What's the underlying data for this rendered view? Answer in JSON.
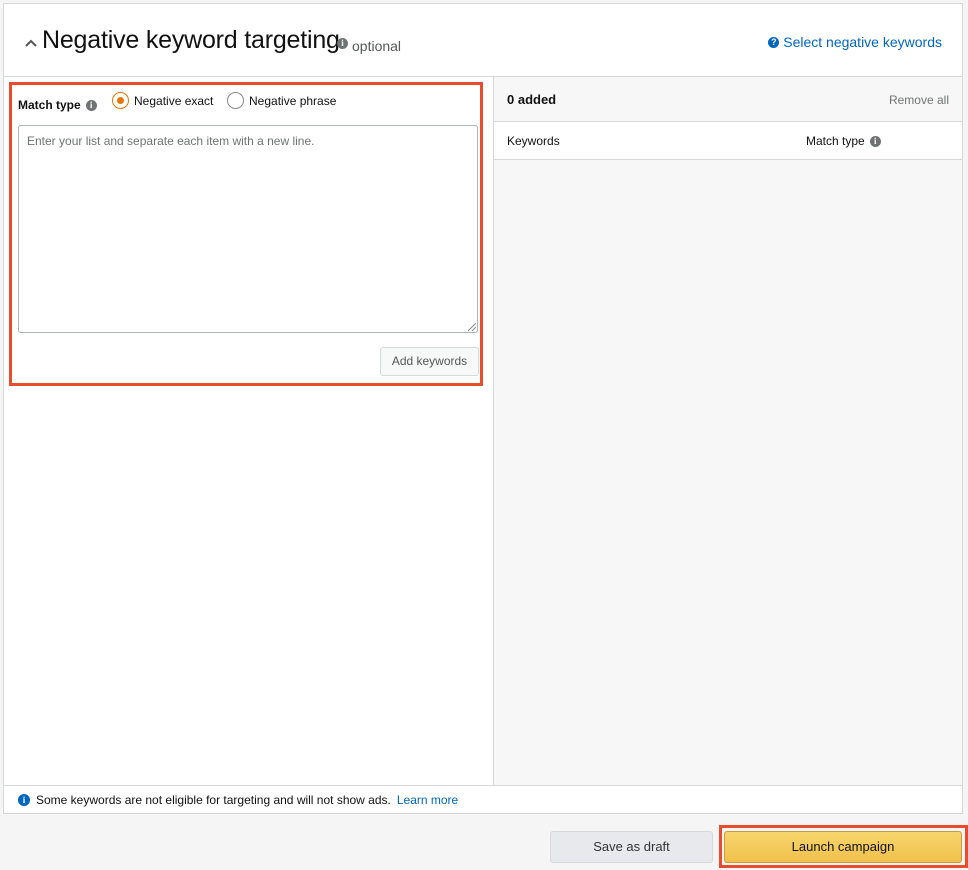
{
  "header": {
    "title": "Negative keyword targeting",
    "optional": "optional",
    "select_link": "Select negative keywords"
  },
  "left": {
    "match_type_label": "Match type",
    "radio_options": [
      {
        "label": "Negative exact",
        "checked": true
      },
      {
        "label": "Negative phrase",
        "checked": false
      }
    ],
    "textarea_placeholder": "Enter your list and separate each item with a new line.",
    "add_button": "Add keywords"
  },
  "right": {
    "added_count": "0 added",
    "remove_all": "Remove all",
    "col_keywords": "Keywords",
    "col_match_type": "Match type"
  },
  "footer": {
    "note": "Some keywords are not eligible for targeting and will not show ads.",
    "learn_more": "Learn more"
  },
  "actions": {
    "save_draft": "Save as draft",
    "launch": "Launch campaign"
  },
  "colors": {
    "accent_orange": "#e77600",
    "link_blue": "#0066c0",
    "highlight_red": "#e74c2c",
    "launch_yellow": "#f0c14b"
  }
}
